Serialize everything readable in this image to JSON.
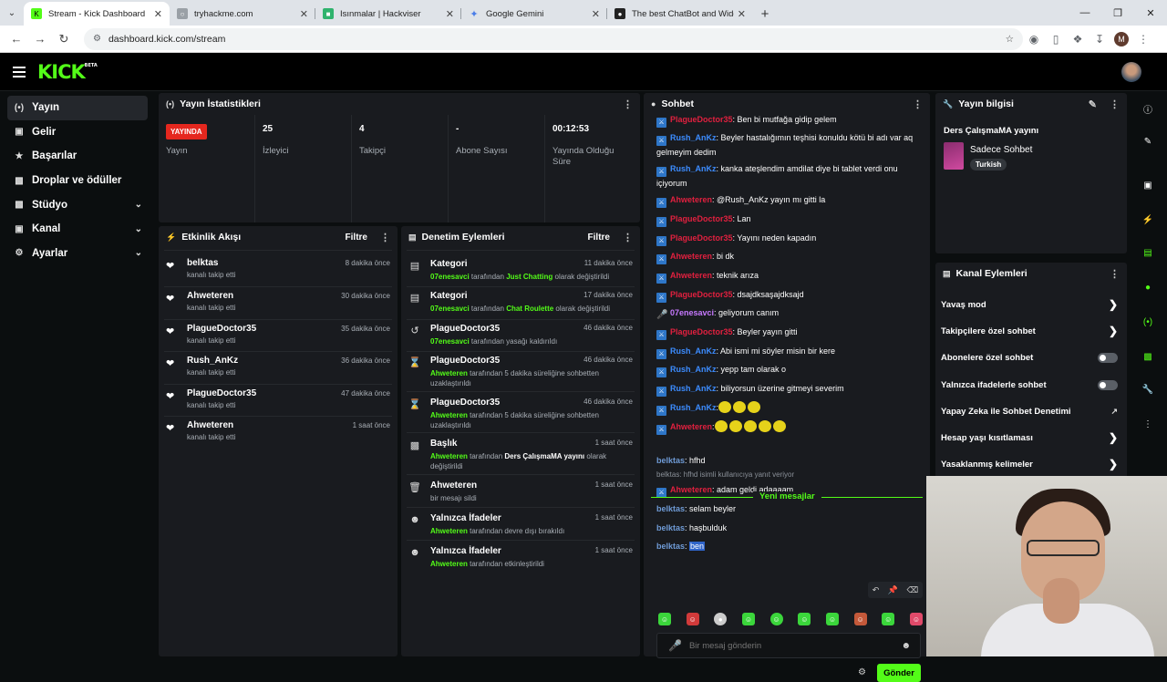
{
  "browser": {
    "tabs": [
      {
        "title": "Stream - Kick Dashboard",
        "active": true,
        "icon": "kick-favicon"
      },
      {
        "title": "tryhackme.com",
        "active": false,
        "icon": "globe-favicon"
      },
      {
        "title": "Isınmalar | Hackviser",
        "active": false,
        "icon": "hackviser-favicon"
      },
      {
        "title": "Google Gemini",
        "active": false,
        "icon": "gemini-favicon"
      },
      {
        "title": "The best ChatBot and Widgets",
        "active": false,
        "icon": "botrix-favicon"
      }
    ],
    "url": "dashboard.kick.com/stream",
    "profile_initial": "M"
  },
  "logo": {
    "text": "KICK",
    "tag": "BETA",
    "color": "#53fc18"
  },
  "sidebar": {
    "items": [
      {
        "label": "Yayın",
        "icon": "broadcast-icon",
        "active": true,
        "expandable": false
      },
      {
        "label": "Gelir",
        "icon": "money-icon",
        "active": false,
        "expandable": false
      },
      {
        "label": "Başarılar",
        "icon": "trophy-icon",
        "active": false,
        "expandable": false
      },
      {
        "label": "Droplar ve ödüller",
        "icon": "gift-icon",
        "active": false,
        "expandable": false
      },
      {
        "label": "Stüdyo",
        "icon": "studio-icon",
        "active": false,
        "expandable": true
      },
      {
        "label": "Kanal",
        "icon": "channel-icon",
        "active": false,
        "expandable": true
      },
      {
        "label": "Ayarlar",
        "icon": "gear-icon",
        "active": false,
        "expandable": true
      }
    ]
  },
  "stats": {
    "title": "Yayın İstatistikleri",
    "items": [
      {
        "value": "YAYINDA",
        "label": "Yayın"
      },
      {
        "value": "25",
        "label": "İzleyici"
      },
      {
        "value": "4",
        "label": "Takipçi"
      },
      {
        "value": "-",
        "label": "Abone Sayısı"
      },
      {
        "value": "00:12:53",
        "label": "Yayında Olduğu Süre"
      }
    ],
    "live_color": "#e5271e"
  },
  "activity": {
    "title": "Etkinlik Akışı",
    "filter_label": "Filtre",
    "items": [
      {
        "name": "belktas",
        "action": "kanalı takip etti",
        "time": "8 dakika önce"
      },
      {
        "name": "Ahweteren",
        "action": "kanalı takip etti",
        "time": "30 dakika önce"
      },
      {
        "name": "PlagueDoctor35",
        "action": "kanalı takip etti",
        "time": "35 dakika önce"
      },
      {
        "name": "Rush_AnKz",
        "action": "kanalı takip etti",
        "time": "36 dakika önce"
      },
      {
        "name": "PlagueDoctor35",
        "action": "kanalı takip etti",
        "time": "47 dakika önce"
      },
      {
        "name": "Ahweteren",
        "action": "kanalı takip etti",
        "time": "1 saat önce"
      }
    ]
  },
  "moderation": {
    "title": "Denetim Eylemleri",
    "filter_label": "Filtre",
    "items": [
      {
        "title": "Kategori",
        "time": "11 dakika önce",
        "icon": "category-icon",
        "actor": "07enesavci",
        "text1": " tarafından ",
        "hl": "Just Chatting",
        "text2": " olarak değiştirildi"
      },
      {
        "title": "Kategori",
        "time": "17 dakika önce",
        "icon": "category-icon",
        "actor": "07enesavci",
        "text1": " tarafından ",
        "hl": "Chat Roulette",
        "text2": " olarak değiştirildi"
      },
      {
        "title": "PlagueDoctor35",
        "time": "46 dakika önce",
        "icon": "unban-icon",
        "actor": "07enesavci",
        "text1": " tarafından yasağı kaldırıldı",
        "hl": "",
        "text2": ""
      },
      {
        "title": "PlagueDoctor35",
        "time": "46 dakika önce",
        "icon": "hourglass-icon",
        "actor": "Ahweteren",
        "text1": " tarafından 5 dakika süreliğine sohbetten uzaklaştırıldı",
        "hl": "",
        "text2": ""
      },
      {
        "title": "PlagueDoctor35",
        "time": "46 dakika önce",
        "icon": "hourglass-icon",
        "actor": "Ahweteren",
        "text1": " tarafından 5 dakika süreliğine sohbetten uzaklaştırıldı",
        "hl": "",
        "text2": ""
      },
      {
        "title": "Başlık",
        "time": "1 saat önce",
        "icon": "title-icon",
        "actor": "Ahweteren",
        "text1": " tarafından ",
        "hl": "Ders ÇalışmaMA yayını",
        "text2": " olarak değiştirildi"
      },
      {
        "title": "Ahweteren",
        "time": "1 saat önce",
        "icon": "trash-icon",
        "actor": "",
        "text1": "bir mesajı sildi",
        "hl": "",
        "text2": ""
      },
      {
        "title": "Yalnızca İfadeler",
        "time": "1 saat önce",
        "icon": "emoji-icon",
        "actor": "Ahweteren",
        "text1": " tarafından devre dışı bırakıldı",
        "hl": "",
        "text2": ""
      },
      {
        "title": "Yalnızca İfadeler",
        "time": "1 saat önce",
        "icon": "emoji-icon",
        "actor": "Ahweteren",
        "text1": " tarafından etkinleştirildi",
        "hl": "",
        "text2": ""
      }
    ]
  },
  "chat": {
    "title": "Sohbet",
    "messages": [
      {
        "user": "PlagueDoctor35",
        "color": "red",
        "badge": "mod",
        "text": ": Ben bi mutfağa gidip gelem"
      },
      {
        "user": "Rush_AnKz",
        "color": "blue",
        "badge": "mod",
        "text": ": Beyler hastalığımın teşhisi konuldu kötü bi adı var aq gelmeyim dedim"
      },
      {
        "user": "Rush_AnKz",
        "color": "blue",
        "badge": "mod",
        "text": ": kanka ateşlendim amdilat diye bi tablet verdi onu içiyorum"
      },
      {
        "user": "Ahweteren",
        "color": "red",
        "badge": "mod",
        "text": ": @Rush_AnKz yayın mı gitti la"
      },
      {
        "user": "PlagueDoctor35",
        "color": "red",
        "badge": "mod",
        "text": ": Lan"
      },
      {
        "user": "PlagueDoctor35",
        "color": "red",
        "badge": "mod",
        "text": ": Yayını neden kapadın"
      },
      {
        "user": "Ahweteren",
        "color": "red",
        "badge": "mod",
        "text": ": bi dk"
      },
      {
        "user": "Ahweteren",
        "color": "red",
        "badge": "mod",
        "text": ": teknik arıza"
      },
      {
        "user": "PlagueDoctor35",
        "color": "red",
        "badge": "mod",
        "text": ": dsajdksaşajdksajd"
      },
      {
        "user": "07enesavci",
        "color": "purple",
        "badge": "mic",
        "text": ": geliyorum canım"
      },
      {
        "user": "PlagueDoctor35",
        "color": "red",
        "badge": "mod",
        "text": ": Beyler yayın gitti"
      },
      {
        "user": "Rush_AnKz",
        "color": "blue",
        "badge": "mod",
        "text": ": Abi ismi mi söyler misin bir kere"
      },
      {
        "user": "Rush_AnKz",
        "color": "blue",
        "badge": "mod",
        "text": ": yepp tam olarak o"
      },
      {
        "user": "Rush_AnKz",
        "color": "blue",
        "badge": "mod",
        "text": ": biliyorsun üzerine gitmeyi severim"
      },
      {
        "user": "Rush_AnKz",
        "color": "blue",
        "badge": "mod",
        "text": ":",
        "emotes": 3
      },
      {
        "user": "Ahweteren",
        "color": "red",
        "badge": "mod",
        "text": ":",
        "emotes": 5
      }
    ],
    "new_messages_label": "Yeni mesajlar",
    "new_messages": [
      {
        "user": "belktas",
        "color": "bel",
        "badge": "",
        "text": ": hfhd"
      },
      {
        "reply_note": "belktas: hfhd isimli kullanıcıya yanıt veriyor"
      },
      {
        "user": "Ahweteren",
        "color": "red",
        "badge": "mod",
        "text": ": adam geldi adaaaam"
      },
      {
        "user": "belktas",
        "color": "bel",
        "badge": "",
        "text": ": selam beyler"
      },
      {
        "user": "belktas",
        "color": "bel",
        "badge": "",
        "text": ": haşbulduk"
      },
      {
        "user": "belktas",
        "color": "bel",
        "badge": "",
        "text": ": ",
        "highlight": "ben"
      }
    ],
    "input_placeholder": "Bir mesaj gönderin",
    "send_label": "Gönder",
    "accent": "#53fc18"
  },
  "stream_info": {
    "title": "Yayın bilgisi",
    "stream_title": "Ders ÇalışmaMA yayını",
    "category": "Sadece Sohbet",
    "language": "Turkish"
  },
  "channel_actions": {
    "title": "Kanal Eylemleri",
    "items": [
      {
        "label": "Yavaş mod",
        "control": "chevron"
      },
      {
        "label": "Takipçilere özel sohbet",
        "control": "chevron"
      },
      {
        "label": "Abonelere özel sohbet",
        "control": "toggle"
      },
      {
        "label": "Yalnızca ifadelerle sohbet",
        "control": "toggle"
      },
      {
        "label": "Yapay Zeka ile Sohbet Denetimi",
        "control": "external"
      },
      {
        "label": "Hesap yaşı kısıtlaması",
        "control": "chevron"
      },
      {
        "label": "Yasaklanmış kelimeler",
        "control": "chevron"
      }
    ]
  },
  "rail": {
    "icons": [
      "info-icon",
      "edit-icon",
      "focus-icon",
      "lightning-icon",
      "notes-icon",
      "chat-icon",
      "broadcast-icon",
      "layout-icon",
      "wrench-icon",
      "more-icon"
    ]
  }
}
